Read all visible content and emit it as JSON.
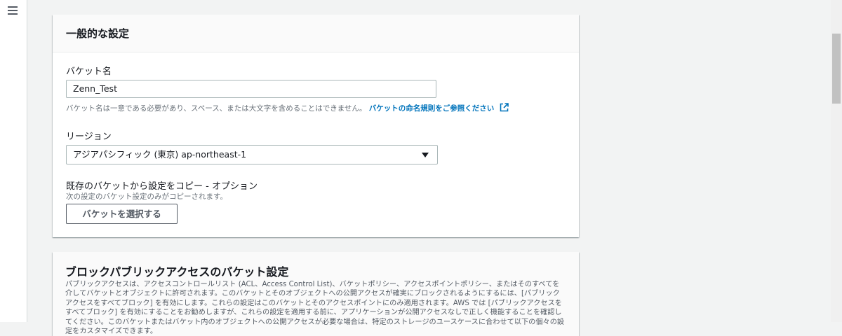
{
  "nav": {
    "menu_icon": "hamburger-menu-icon"
  },
  "general": {
    "title": "一般的な設定",
    "bucket_name_label": "バケット名",
    "bucket_name_value": "Zenn_Test",
    "bucket_name_hint": "バケット名は一意である必要があり、スペース、または大文字を含めることはできません。",
    "naming_rules_link": "バケットの命名規則をご参照ください",
    "region_label": "リージョン",
    "region_value": "アジアパシフィック (東京) ap-northeast-1",
    "copy_label": "既存のバケットから設定をコピー - オプション",
    "copy_hint": "次の設定のバケット設定のみがコピーされます。",
    "choose_bucket_button": "バケットを選択する"
  },
  "block_public_access": {
    "title": "ブロックパブリックアクセスのバケット設定",
    "description": "パブリックアクセスは、アクセスコントロールリスト (ACL、Access Control List)、バケットポリシー、アクセスポイントポリシー、またはそのすべてを介してバケットとオブジェクトに許可されます。このバケットとそのオブジェクトへの公開アクセスが確実にブロックされるようにするには、[パブリックアクセスをすべてブロック] を有効にします。これらの設定はこのバケットとそのアクセスポイントにのみ適用されます。AWS では [パブリックアクセスをすべてブロック] を有効にすることをお勧めしますが、これらの設定を適用する前に、アプリケーションが公開アクセスなしで正しく機能することを確認してください。このバケットまたはバケット内のオブジェクトへの公開アクセスが必要な場合は、特定のストレージのユースケースに合わせて以下の個々の設定をカスタマイズできます。"
  },
  "colors": {
    "link": "#0073bb",
    "background": "#f2f3f3",
    "border": "#aab7b8"
  }
}
